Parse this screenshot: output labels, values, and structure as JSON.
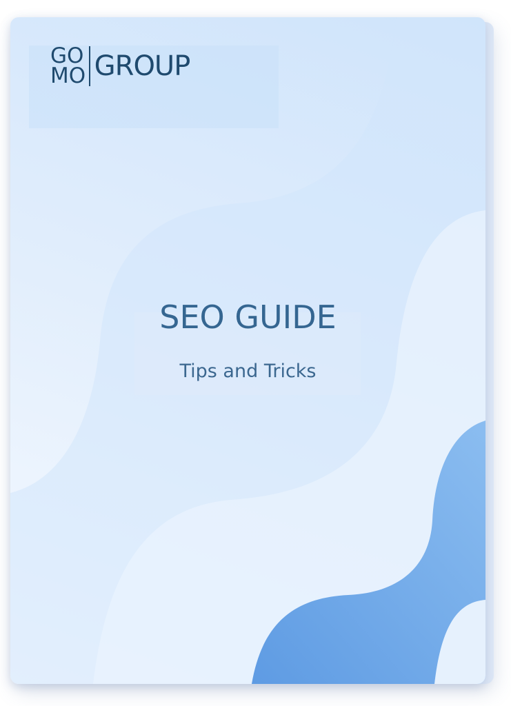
{
  "logo": {
    "mark_line1": "GO",
    "mark_line2": "MO",
    "wordmark": "GROUP"
  },
  "cover": {
    "title": "SEO GUIDE",
    "subtitle": "Tips and Tricks"
  },
  "colors": {
    "text_primary": "#356691",
    "logo": "#1f4a6e",
    "accent_wave": "#6aa2e4",
    "background_light": "#e0edfc"
  }
}
